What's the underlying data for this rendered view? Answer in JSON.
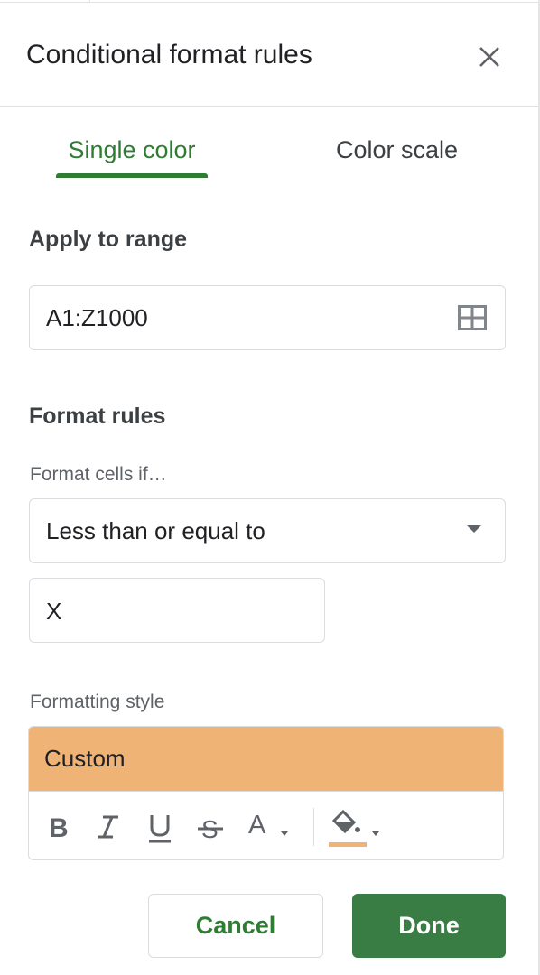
{
  "panel": {
    "title": "Conditional format rules",
    "close_icon": "close-icon"
  },
  "tabs": {
    "single": "Single color",
    "scale": "Color scale",
    "active_color": "#2e7d32"
  },
  "range": {
    "label": "Apply to range",
    "value": "A1:Z1000",
    "icon": "grid-icon"
  },
  "rules": {
    "label": "Format rules",
    "condition_label": "Format cells if…",
    "condition_value": "Less than or equal to",
    "value": "X"
  },
  "style": {
    "label": "Formatting style",
    "preview_text": "Custom",
    "preview_color": "#efb376",
    "fill_color_swatch": "#efb376",
    "toolbar": [
      "bold-icon",
      "italic-icon",
      "underline-icon",
      "strikethrough-icon",
      "text-color-icon",
      "fill-color-icon"
    ]
  },
  "actions": {
    "cancel": "Cancel",
    "done": "Done",
    "done_color": "#3a7d44"
  }
}
